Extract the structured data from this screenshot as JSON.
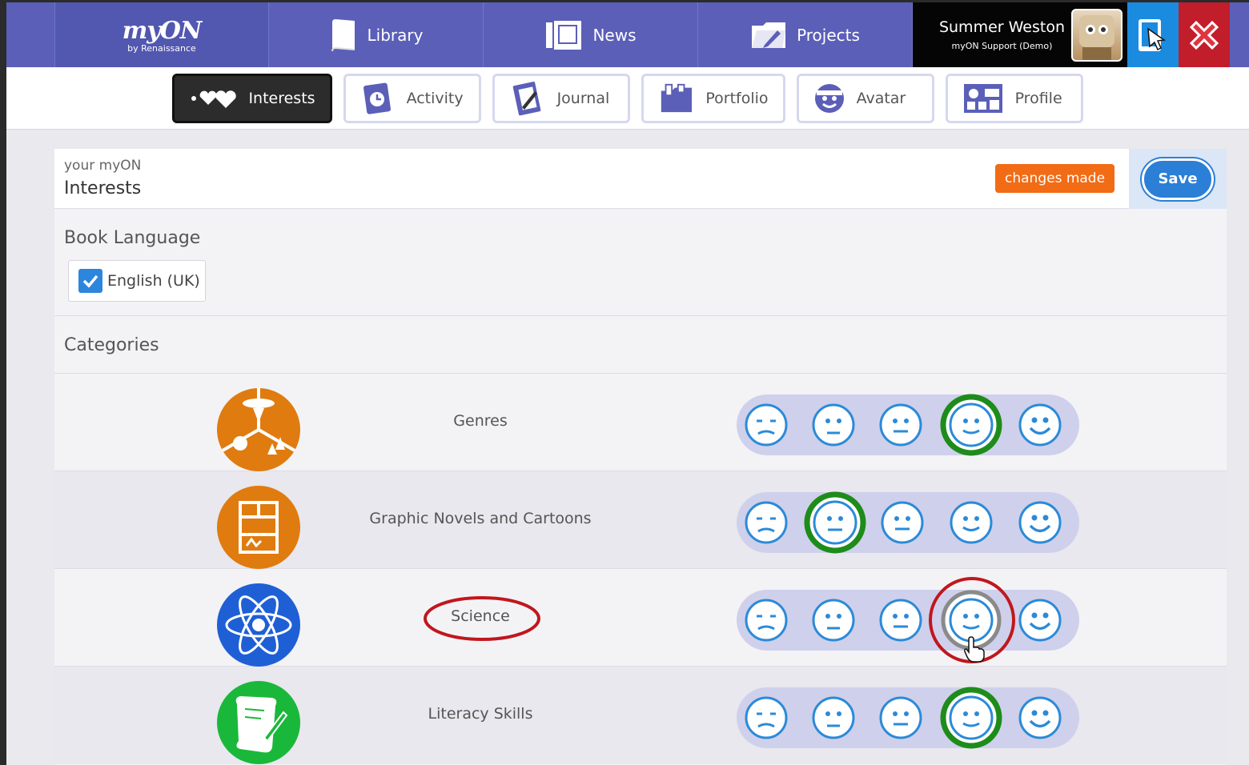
{
  "topbar": {
    "logo_main": "myON",
    "logo_sub": "by Renaissance",
    "nav": [
      {
        "label": "Library",
        "icon": "book-icon"
      },
      {
        "label": "News",
        "icon": "newspaper-icon"
      },
      {
        "label": "Projects",
        "icon": "folder-pen-icon"
      }
    ],
    "user_name": "Summer Weston",
    "user_sub": "myON Support (Demo)"
  },
  "subnav": [
    {
      "label": "Interests",
      "icon": "hearts-icon",
      "active": true
    },
    {
      "label": "Activity",
      "icon": "clock-book-icon",
      "active": false
    },
    {
      "label": "Journal",
      "icon": "journal-icon",
      "active": false
    },
    {
      "label": "Portfolio",
      "icon": "portfolio-icon",
      "active": false
    },
    {
      "label": "Avatar",
      "icon": "face-icon",
      "active": false
    },
    {
      "label": "Profile",
      "icon": "profile-icon",
      "active": false
    }
  ],
  "panel": {
    "crumb_small": "your myON",
    "crumb_title": "Interests",
    "badge": "changes made",
    "save_label": "Save"
  },
  "book_language": {
    "title": "Book Language",
    "option": "English (UK)",
    "checked": true
  },
  "categories": {
    "title": "Categories",
    "rows": [
      {
        "label": "Genres",
        "icon": "genres-icon",
        "color": "#e07b10",
        "rating": 4
      },
      {
        "label": "Graphic Novels and Cartoons",
        "icon": "comic-icon",
        "color": "#e07b10",
        "rating": 2
      },
      {
        "label": "Science",
        "icon": "atom-icon",
        "color": "#1f5fd6",
        "rating": 4
      },
      {
        "label": "Literacy Skills",
        "icon": "scroll-icon",
        "color": "#19b83a",
        "rating": 4
      }
    ]
  },
  "colors": {
    "accent": "#5b5fb8",
    "selected_ring": "#1e8c1a",
    "face_blue": "#2b8ad8",
    "annotation_red": "#c0171d"
  }
}
